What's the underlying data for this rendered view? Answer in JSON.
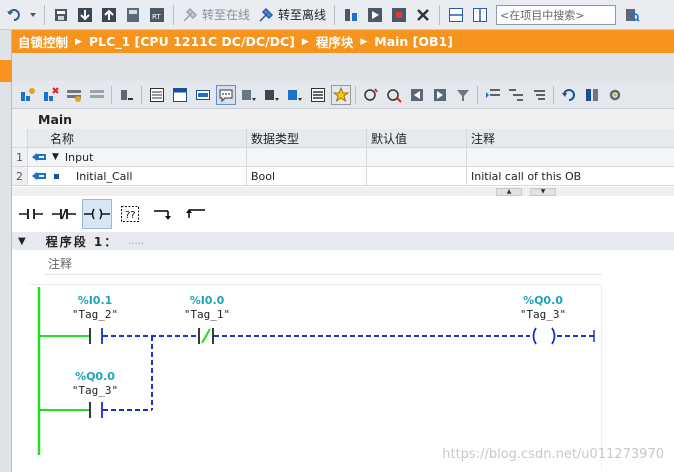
{
  "toolbar": {
    "go_online_label": "转至在线",
    "go_offline_label": "转至离线",
    "search_placeholder": "<在项目中搜索>"
  },
  "breadcrumb": {
    "items": [
      "自锁控制",
      "PLC_1 [CPU 1211C DC/DC/DC]",
      "程序块",
      "Main [OB1]"
    ]
  },
  "interface": {
    "title": "Main",
    "headers": {
      "name": "名称",
      "type": "数据类型",
      "default": "默认值",
      "comment": "注释"
    },
    "rows": [
      {
        "num": "1",
        "name": "Input",
        "type": "",
        "default": "",
        "comment": ""
      },
      {
        "num": "2",
        "name": "Initial_Call",
        "type": "Bool",
        "default": "",
        "comment": "Initial call of this OB"
      }
    ]
  },
  "network": {
    "title": "程序段 1：",
    "dots": ".....",
    "comment": "注释"
  },
  "ladder": {
    "contacts": [
      {
        "address": "%I0.1",
        "tag": "\"Tag_2\"",
        "type": "NO"
      },
      {
        "address": "%I0.0",
        "tag": "\"Tag_1\"",
        "type": "NC"
      },
      {
        "address": "%Q0.0",
        "tag": "\"Tag_3\"",
        "type": "NO"
      }
    ],
    "coil": {
      "address": "%Q0.0",
      "tag": "\"Tag_3\""
    }
  },
  "watermark": "https://blog.csdn.net/u011273970",
  "colors": {
    "accent": "#f7941d",
    "rail": "#22dd22",
    "wire": "#1a2fd0",
    "address": "#1aa6b7"
  }
}
